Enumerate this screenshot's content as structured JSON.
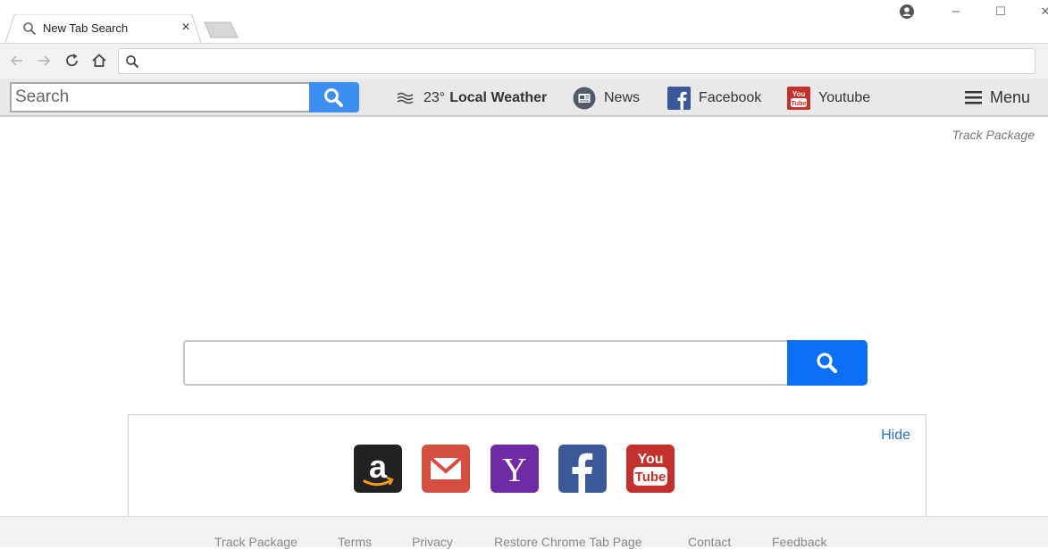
{
  "browser": {
    "tab_title": "New Tab Search",
    "tab_close": "×",
    "window_minimize": "–",
    "window_maximize": "☐",
    "window_close": "✕",
    "omnibox": {
      "value": "",
      "placeholder": ""
    }
  },
  "extension_bar": {
    "search_placeholder": "Search",
    "weather_temp": "23°",
    "weather_label": "Local Weather",
    "news_label": "News",
    "facebook_label": "Facebook",
    "youtube_label": "Youtube",
    "menu_label": "Menu",
    "colors": {
      "search_button": "#3d8ef1",
      "facebook": "#3b5998",
      "youtube": "#c4302b"
    }
  },
  "page": {
    "track_package_link": "Track Package",
    "main_search": {
      "value": "",
      "placeholder": ""
    },
    "shortcuts": {
      "hide_label": "Hide",
      "items": [
        {
          "name": "Amazon",
          "icon": "amazon-icon",
          "color": "#222222"
        },
        {
          "name": "Gmail",
          "icon": "mail-icon",
          "color": "#d44f3f"
        },
        {
          "name": "Yahoo",
          "icon": "yahoo-icon",
          "color": "#6e2ba3"
        },
        {
          "name": "Facebook",
          "icon": "facebook-icon",
          "color": "#3b5998"
        },
        {
          "name": "YouTube",
          "icon": "youtube-icon",
          "color": "#c4302b"
        }
      ]
    },
    "footer_links": [
      "Track Package",
      "Terms",
      "Privacy",
      "Restore Chrome Tab Page",
      "Contact",
      "Feedback"
    ]
  }
}
